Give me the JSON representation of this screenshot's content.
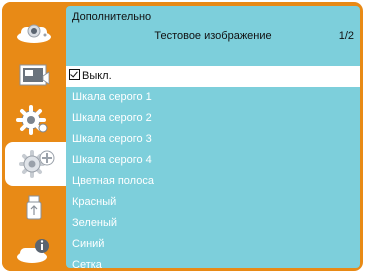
{
  "menu": {
    "title": "Дополнительно",
    "subtitle": "Тестовое изображение",
    "page_indicator": "1/2"
  },
  "sidebar": {
    "icons": [
      "display-settings-icon",
      "projection-mode-icon",
      "settings-gear-icon",
      "advanced-settings-icon",
      "usb-icon",
      "information-icon"
    ],
    "selected_index": 3
  },
  "options": {
    "items": [
      {
        "label": "Выкл.",
        "selected": true
      },
      {
        "label": "Шкала серого 1",
        "selected": false
      },
      {
        "label": "Шкала серого 2",
        "selected": false
      },
      {
        "label": "Шкала серого 3",
        "selected": false
      },
      {
        "label": "Шкала серого 4",
        "selected": false
      },
      {
        "label": "Цветная полоса",
        "selected": false
      },
      {
        "label": "Красный",
        "selected": false
      },
      {
        "label": "Зеленый",
        "selected": false
      },
      {
        "label": "Синий",
        "selected": false
      },
      {
        "label": "Сетка",
        "selected": false
      }
    ]
  },
  "colors": {
    "rail": "#e88a16",
    "panel": "#7dcfdb",
    "highlight": "#ffffff",
    "text_on_panel": "#ffffff",
    "text_dark": "#111111"
  }
}
